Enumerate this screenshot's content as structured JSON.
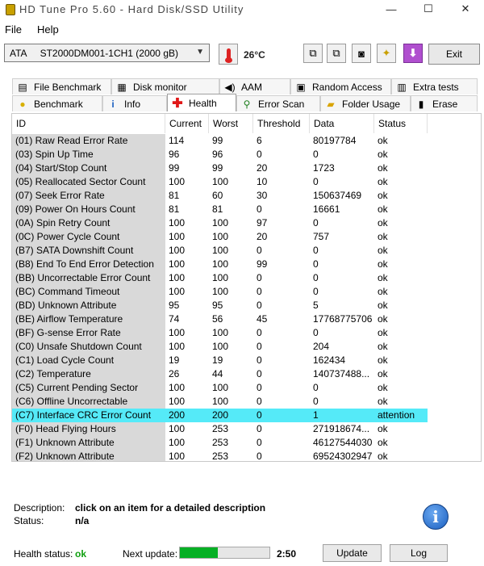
{
  "window": {
    "title": "HD Tune Pro 5.60 - Hard Disk/SSD Utility",
    "minimize": "—",
    "maximize": "☐",
    "close": "✕"
  },
  "menu": {
    "file": "File",
    "help": "Help"
  },
  "toolbar": {
    "drive": "ATA     ST2000DM001-1CH1 (2000 gB)",
    "temperature": "26°C",
    "exit_label": "Exit"
  },
  "tabs_top": [
    {
      "label": "File Benchmark",
      "icon": "file-benchmark-icon"
    },
    {
      "label": "Disk monitor",
      "icon": "disk-monitor-icon"
    },
    {
      "label": "AAM",
      "icon": "speaker-icon"
    },
    {
      "label": "Random Access",
      "icon": "random-access-icon"
    },
    {
      "label": "Extra tests",
      "icon": "extra-tests-icon"
    }
  ],
  "tabs_bottom": [
    {
      "label": "Benchmark",
      "icon": "bulb-icon"
    },
    {
      "label": "Info",
      "icon": "info-icon"
    },
    {
      "label": "Health",
      "icon": "health-cross-icon",
      "active": true
    },
    {
      "label": "Error Scan",
      "icon": "magnifier-icon"
    },
    {
      "label": "Folder Usage",
      "icon": "folder-icon"
    },
    {
      "label": "Erase",
      "icon": "trash-icon"
    }
  ],
  "table": {
    "headers": [
      "ID",
      "Current",
      "Worst",
      "Threshold",
      "Data",
      "Status"
    ],
    "rows": [
      [
        "(01) Raw Read Error Rate",
        "114",
        "99",
        "6",
        "80197784",
        "ok"
      ],
      [
        "(03) Spin Up Time",
        "96",
        "96",
        "0",
        "0",
        "ok"
      ],
      [
        "(04) Start/Stop Count",
        "99",
        "99",
        "20",
        "1723",
        "ok"
      ],
      [
        "(05) Reallocated Sector Count",
        "100",
        "100",
        "10",
        "0",
        "ok"
      ],
      [
        "(07) Seek Error Rate",
        "81",
        "60",
        "30",
        "150637469",
        "ok"
      ],
      [
        "(09) Power On Hours Count",
        "81",
        "81",
        "0",
        "16661",
        "ok"
      ],
      [
        "(0A) Spin Retry Count",
        "100",
        "100",
        "97",
        "0",
        "ok"
      ],
      [
        "(0C) Power Cycle Count",
        "100",
        "100",
        "20",
        "757",
        "ok"
      ],
      [
        "(B7) SATA Downshift Count",
        "100",
        "100",
        "0",
        "0",
        "ok"
      ],
      [
        "(B8) End To End Error Detection",
        "100",
        "100",
        "99",
        "0",
        "ok"
      ],
      [
        "(BB) Uncorrectable Error Count",
        "100",
        "100",
        "0",
        "0",
        "ok"
      ],
      [
        "(BC) Command Timeout",
        "100",
        "100",
        "0",
        "0",
        "ok"
      ],
      [
        "(BD) Unknown Attribute",
        "95",
        "95",
        "0",
        "5",
        "ok"
      ],
      [
        "(BE) Airflow Temperature",
        "74",
        "56",
        "45",
        "17768775706",
        "ok"
      ],
      [
        "(BF) G-sense Error Rate",
        "100",
        "100",
        "0",
        "0",
        "ok"
      ],
      [
        "(C0) Unsafe Shutdown Count",
        "100",
        "100",
        "0",
        "204",
        "ok"
      ],
      [
        "(C1) Load Cycle Count",
        "19",
        "19",
        "0",
        "162434",
        "ok"
      ],
      [
        "(C2) Temperature",
        "26",
        "44",
        "0",
        "140737488...",
        "ok"
      ],
      [
        "(C5) Current Pending Sector",
        "100",
        "100",
        "0",
        "0",
        "ok"
      ],
      [
        "(C6) Offline Uncorrectable",
        "100",
        "100",
        "0",
        "0",
        "ok"
      ],
      [
        "(C7) Interface CRC Error Count",
        "200",
        "200",
        "0",
        "1",
        "attention"
      ],
      [
        "(F0) Head Flying Hours",
        "100",
        "253",
        "0",
        "271918674...",
        "ok"
      ],
      [
        "(F1) Unknown Attribute",
        "100",
        "253",
        "0",
        "46127544030",
        "ok"
      ],
      [
        "(F2) Unknown Attribute",
        "100",
        "253",
        "0",
        "69524302947",
        "ok"
      ]
    ],
    "selected_row": 20
  },
  "details": {
    "description_label": "Description:",
    "description_value": "click on an item for a detailed description",
    "status_label": "Status:",
    "status_value": "n/a"
  },
  "footer": {
    "health_label": "Health status:",
    "health_value": "ok",
    "next_update_label": "Next update:",
    "progress_fraction": 0.42,
    "time": "2:50",
    "update_label": "Update",
    "log_label": "Log"
  },
  "colors": {
    "selected_row": "#55eaf8",
    "health_ok": "#10a010",
    "progress": "#06b025"
  }
}
